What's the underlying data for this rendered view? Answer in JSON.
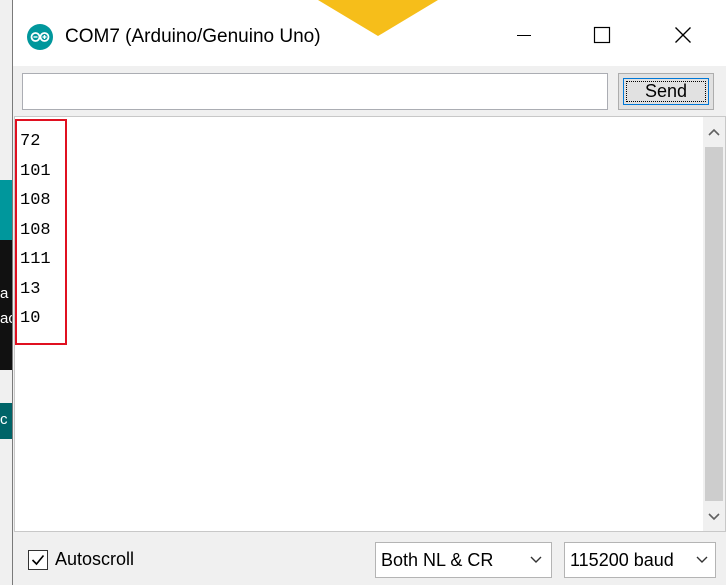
{
  "window": {
    "title": "COM7 (Arduino/Genuino Uno)",
    "icon": "arduino-logo-icon",
    "controls": [
      "minimize-icon",
      "maximize-icon",
      "close-icon"
    ]
  },
  "send_bar": {
    "input_value": "",
    "send_label": "Send"
  },
  "serial_output": {
    "lines": [
      "72",
      "101",
      "108",
      "108",
      "111",
      "13",
      "10"
    ]
  },
  "bottom_bar": {
    "autoscroll_label": "Autoscroll",
    "autoscroll_checked": true,
    "line_ending": "Both NL & CR",
    "baud_rate": "115200 baud"
  },
  "background": {
    "left_chars": [
      "a",
      "ac",
      "c"
    ]
  },
  "colors": {
    "arduino_teal": "#00979c",
    "highlight_red": "#e01020",
    "focus_blue": "#0078d7"
  }
}
